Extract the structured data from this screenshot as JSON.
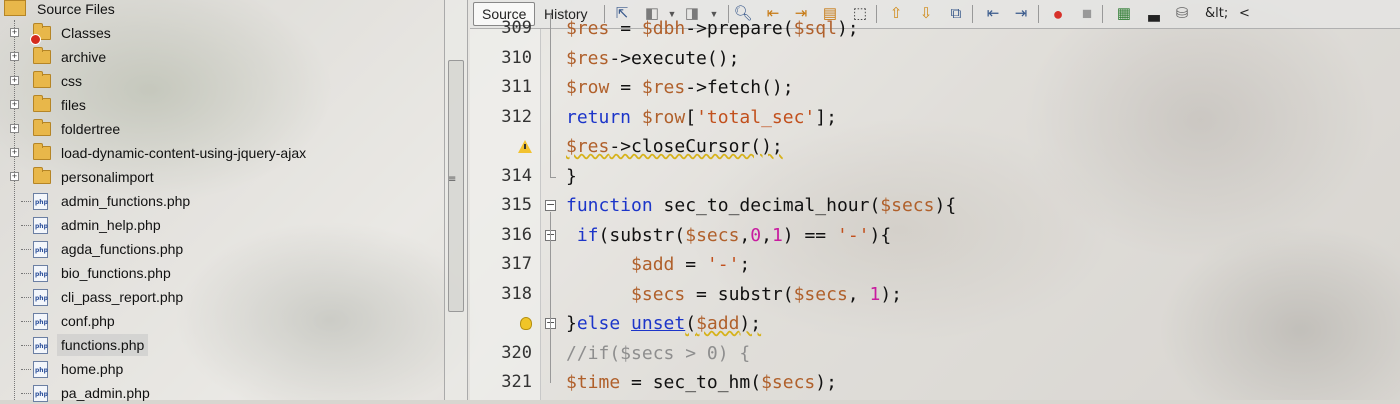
{
  "project_tree": {
    "root_label": "Source Files",
    "items": [
      {
        "label": "Classes",
        "type": "folder",
        "badge": true
      },
      {
        "label": "archive",
        "type": "folder"
      },
      {
        "label": "css",
        "type": "folder"
      },
      {
        "label": "files",
        "type": "folder"
      },
      {
        "label": "foldertree",
        "type": "folder"
      },
      {
        "label": "load-dynamic-content-using-jquery-ajax",
        "type": "folder"
      },
      {
        "label": "personalimport",
        "type": "folder"
      },
      {
        "label": "admin_functions.php",
        "type": "file"
      },
      {
        "label": "admin_help.php",
        "type": "file"
      },
      {
        "label": "agda_functions.php",
        "type": "file"
      },
      {
        "label": "bio_functions.php",
        "type": "file"
      },
      {
        "label": "cli_pass_report.php",
        "type": "file"
      },
      {
        "label": "conf.php",
        "type": "file"
      },
      {
        "label": "functions.php",
        "type": "file",
        "selected": true
      },
      {
        "label": "home.php",
        "type": "file"
      },
      {
        "label": "pa_admin.php",
        "type": "file"
      }
    ]
  },
  "editor": {
    "tabs": {
      "source": "Source",
      "history": "History"
    },
    "toolbar_text": {
      "html_entity": "&lt;",
      "angle": "<"
    },
    "lines": [
      {
        "num": "309",
        "tokens": [
          [
            "v",
            "$res"
          ],
          [
            "p",
            " = "
          ],
          [
            "v",
            "$dbh"
          ],
          [
            "p",
            "->prepare("
          ],
          [
            "v",
            "$sql"
          ],
          [
            "p",
            ");"
          ]
        ]
      },
      {
        "num": "310",
        "tokens": [
          [
            "v",
            "$res"
          ],
          [
            "p",
            "->execute();"
          ]
        ]
      },
      {
        "num": "311",
        "tokens": [
          [
            "v",
            "$row"
          ],
          [
            "p",
            " = "
          ],
          [
            "v",
            "$res"
          ],
          [
            "p",
            "->fetch();"
          ]
        ]
      },
      {
        "num": "312",
        "tokens": [
          [
            "k",
            "return "
          ],
          [
            "v",
            "$row"
          ],
          [
            "p",
            "["
          ],
          [
            "s",
            "'total_sec'"
          ],
          [
            "p",
            "];"
          ]
        ]
      },
      {
        "num": "",
        "marker": "warning",
        "tokens": [
          [
            "vu",
            "$res"
          ],
          [
            "pu",
            "->closeCursor();"
          ]
        ]
      },
      {
        "num": "314",
        "tokens": [
          [
            "p",
            "}"
          ]
        ]
      },
      {
        "num": "315",
        "tokens": [
          [
            "k",
            "function "
          ],
          [
            "p",
            "sec_to_decimal_hour("
          ],
          [
            "v",
            "$secs"
          ],
          [
            "p",
            "){"
          ]
        ]
      },
      {
        "num": "316",
        "tokens": [
          [
            "p",
            " "
          ],
          [
            "k",
            "if"
          ],
          [
            "p",
            "(substr("
          ],
          [
            "v",
            "$secs"
          ],
          [
            "p",
            ","
          ],
          [
            "n",
            "0"
          ],
          [
            "p",
            ","
          ],
          [
            "n",
            "1"
          ],
          [
            "p",
            ") == "
          ],
          [
            "s",
            "'-'"
          ],
          [
            "p",
            "){"
          ]
        ]
      },
      {
        "num": "317",
        "tokens": [
          [
            "p",
            "      "
          ],
          [
            "v",
            "$add"
          ],
          [
            "p",
            " = "
          ],
          [
            "s",
            "'-'"
          ],
          [
            "p",
            ";"
          ]
        ]
      },
      {
        "num": "318",
        "tokens": [
          [
            "p",
            "      "
          ],
          [
            "v",
            "$secs"
          ],
          [
            "p",
            " = substr("
          ],
          [
            "v",
            "$secs"
          ],
          [
            "p",
            ", "
          ],
          [
            "n",
            "1"
          ],
          [
            "p",
            ");"
          ]
        ]
      },
      {
        "num": "",
        "marker": "bulb",
        "tokens": [
          [
            "p",
            "}"
          ],
          [
            "k",
            "else "
          ],
          [
            "unset",
            "unset"
          ],
          [
            "pu",
            "("
          ],
          [
            "vu",
            "$add"
          ],
          [
            "pu",
            ");"
          ]
        ]
      },
      {
        "num": "320",
        "tokens": [
          [
            "c",
            "//if($secs > 0) {"
          ]
        ]
      },
      {
        "num": "321",
        "tokens": [
          [
            "v",
            "$time"
          ],
          [
            "p",
            " = sec_to_hm("
          ],
          [
            "v",
            "$secs"
          ],
          [
            "p",
            ");"
          ]
        ]
      }
    ]
  },
  "colors": {
    "variable": "#b0602b",
    "keyword": "#1c35c9",
    "string": "#c2501d",
    "number": "#c81b9f",
    "comment": "#8e8e8e"
  }
}
